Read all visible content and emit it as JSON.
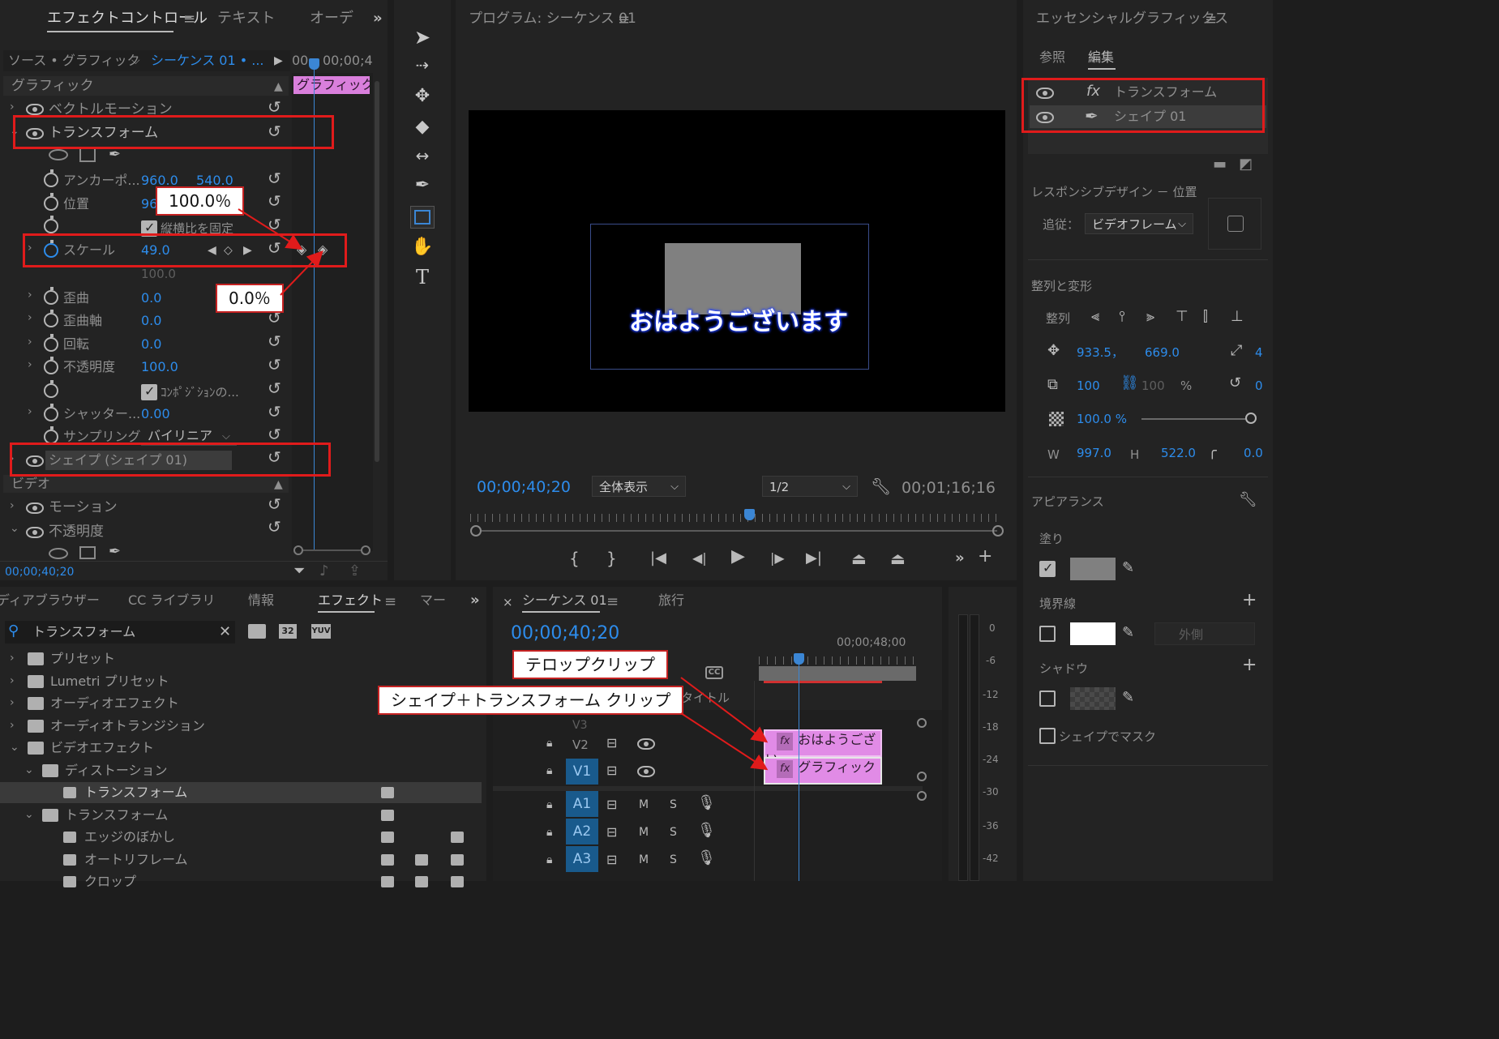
{
  "effect_controls": {
    "tabs": [
      "エフェクトコントロール",
      "テキスト",
      "オーデ"
    ],
    "source_label": "ソース • グラフィック",
    "sequence_label": "シーケンス 01 • ...",
    "time_start": "00",
    "time_end": "00;00;4",
    "clip_label": "グラフィック",
    "section_graphic": "グラフィック",
    "vector_motion": "ベクトルモーション",
    "transform": "トランスフォーム",
    "props": {
      "anchor_label": "アンカーポ...",
      "anchor_x": "960.0",
      "anchor_y": "540.0",
      "position_label": "位置",
      "position_x": "96",
      "aspect_label": "縦横比を固定",
      "scale_label": "スケール",
      "scale_value": "49.0",
      "scale_width_value": "100.0",
      "skew_label": "歪曲",
      "skew_value": "0.0",
      "skew_axis_label": "歪曲軸",
      "skew_axis_value": "0.0",
      "rotation_label": "回転",
      "rotation_value": "0.0",
      "opacity_label": "不透明度",
      "opacity_value": "100.0",
      "composite_label": "ｺﾝﾎﾟｼﾞｼｮﾝの...",
      "shutter_label": "シャッター...",
      "shutter_value": "0.00",
      "sampling_label": "サンプリング",
      "sampling_value": "バイリニア"
    },
    "shape_item": "シェイプ (シェイプ 01)",
    "section_video": "ビデオ",
    "motion": "モーション",
    "video_opacity": "不透明度",
    "timecode": "00;00;40;20"
  },
  "callouts": {
    "kf_100": "100.0％",
    "kf_0": "0.0％",
    "telop": "テロップクリップ",
    "shape_transform": "シェイプ＋トランスフォーム クリップ"
  },
  "program": {
    "title": "プログラム: シーケンス 01",
    "overlay_text": "おはようございます",
    "timecode": "00;00;40;20",
    "zoom": "全体表示",
    "resolution": "1/2",
    "duration": "00;01;16;16"
  },
  "essential": {
    "title": "エッセンシャルグラフィックス",
    "tab_browse": "参照",
    "tab_edit": "編集",
    "layer_transform": "トランスフォーム",
    "layer_shape": "シェイプ 01",
    "responsive": "レスポンシブデザイン － 位置",
    "follow_label": "追従：",
    "follow_value": "ビデオフレーム",
    "align_header": "整列と変形",
    "align_label": "整列",
    "pos_x": "933.5，",
    "pos_y": "669.0",
    "rot_partial": "4",
    "scale_w": "100",
    "scale_h": "100",
    "percent": "%",
    "rotation": "0",
    "opacity": "100.0 %",
    "w_label": "W",
    "w_value": "997.0",
    "h_label": "H",
    "h_value": "522.0",
    "corner": "0.0",
    "appearance": "アピアランス",
    "fill": "塗り",
    "stroke": "境界線",
    "stroke_pos": "外側",
    "shadow": "シャドウ",
    "mask": "シェイプでマスク"
  },
  "effects_panel": {
    "tabs": [
      "ディアブラウザー",
      "CC ライブラリ",
      "情報",
      "エフェクト",
      "マー"
    ],
    "search": "トランスフォーム",
    "items": [
      {
        "label": "プリセット",
        "indent": 0
      },
      {
        "label": "Lumetri プリセット",
        "indent": 0
      },
      {
        "label": "オーディオエフェクト",
        "indent": 0
      },
      {
        "label": "オーディオトランジション",
        "indent": 0
      },
      {
        "label": "ビデオエフェクト",
        "indent": 0
      },
      {
        "label": "ディストーション",
        "indent": 1
      },
      {
        "label": "トランスフォーム",
        "indent": 2
      },
      {
        "label": "トランスフォーム",
        "indent": 1
      },
      {
        "label": "エッジのぼかし",
        "indent": 2
      },
      {
        "label": "オートリフレーム",
        "indent": 2
      },
      {
        "label": "クロップ",
        "indent": 2
      }
    ]
  },
  "timeline": {
    "tab": "シーケンス 01",
    "tab2": "旅行",
    "timecode": "00;00;40;20",
    "ruler_time": "00;00;48;00",
    "title_label": "タイトル",
    "tracks_video": [
      "V3",
      "V2",
      "V1"
    ],
    "tracks_audio": [
      "A1",
      "A2",
      "A3"
    ],
    "clip_v2": "おはようござい",
    "clip_v1": "グラフィック",
    "meter_ticks": [
      "0",
      "-6",
      "-12",
      "-18",
      "-24",
      "-30",
      "-36",
      "-42"
    ]
  }
}
